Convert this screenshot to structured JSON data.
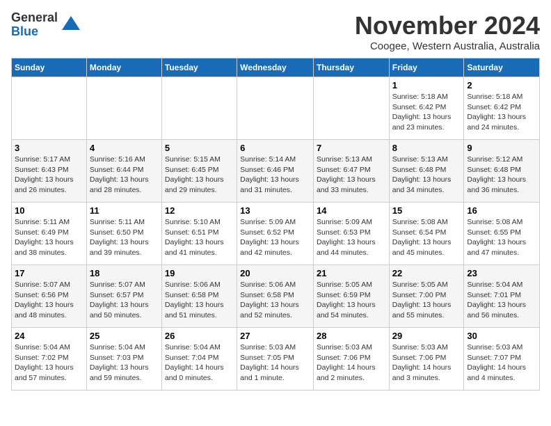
{
  "logo": {
    "general": "General",
    "blue": "Blue"
  },
  "title": "November 2024",
  "location": "Coogee, Western Australia, Australia",
  "days_of_week": [
    "Sunday",
    "Monday",
    "Tuesday",
    "Wednesday",
    "Thursday",
    "Friday",
    "Saturday"
  ],
  "weeks": [
    [
      {
        "day": "",
        "info": ""
      },
      {
        "day": "",
        "info": ""
      },
      {
        "day": "",
        "info": ""
      },
      {
        "day": "",
        "info": ""
      },
      {
        "day": "",
        "info": ""
      },
      {
        "day": "1",
        "info": "Sunrise: 5:18 AM\nSunset: 6:42 PM\nDaylight: 13 hours\nand 23 minutes."
      },
      {
        "day": "2",
        "info": "Sunrise: 5:18 AM\nSunset: 6:42 PM\nDaylight: 13 hours\nand 24 minutes."
      }
    ],
    [
      {
        "day": "3",
        "info": "Sunrise: 5:17 AM\nSunset: 6:43 PM\nDaylight: 13 hours\nand 26 minutes."
      },
      {
        "day": "4",
        "info": "Sunrise: 5:16 AM\nSunset: 6:44 PM\nDaylight: 13 hours\nand 28 minutes."
      },
      {
        "day": "5",
        "info": "Sunrise: 5:15 AM\nSunset: 6:45 PM\nDaylight: 13 hours\nand 29 minutes."
      },
      {
        "day": "6",
        "info": "Sunrise: 5:14 AM\nSunset: 6:46 PM\nDaylight: 13 hours\nand 31 minutes."
      },
      {
        "day": "7",
        "info": "Sunrise: 5:13 AM\nSunset: 6:47 PM\nDaylight: 13 hours\nand 33 minutes."
      },
      {
        "day": "8",
        "info": "Sunrise: 5:13 AM\nSunset: 6:48 PM\nDaylight: 13 hours\nand 34 minutes."
      },
      {
        "day": "9",
        "info": "Sunrise: 5:12 AM\nSunset: 6:48 PM\nDaylight: 13 hours\nand 36 minutes."
      }
    ],
    [
      {
        "day": "10",
        "info": "Sunrise: 5:11 AM\nSunset: 6:49 PM\nDaylight: 13 hours\nand 38 minutes."
      },
      {
        "day": "11",
        "info": "Sunrise: 5:11 AM\nSunset: 6:50 PM\nDaylight: 13 hours\nand 39 minutes."
      },
      {
        "day": "12",
        "info": "Sunrise: 5:10 AM\nSunset: 6:51 PM\nDaylight: 13 hours\nand 41 minutes."
      },
      {
        "day": "13",
        "info": "Sunrise: 5:09 AM\nSunset: 6:52 PM\nDaylight: 13 hours\nand 42 minutes."
      },
      {
        "day": "14",
        "info": "Sunrise: 5:09 AM\nSunset: 6:53 PM\nDaylight: 13 hours\nand 44 minutes."
      },
      {
        "day": "15",
        "info": "Sunrise: 5:08 AM\nSunset: 6:54 PM\nDaylight: 13 hours\nand 45 minutes."
      },
      {
        "day": "16",
        "info": "Sunrise: 5:08 AM\nSunset: 6:55 PM\nDaylight: 13 hours\nand 47 minutes."
      }
    ],
    [
      {
        "day": "17",
        "info": "Sunrise: 5:07 AM\nSunset: 6:56 PM\nDaylight: 13 hours\nand 48 minutes."
      },
      {
        "day": "18",
        "info": "Sunrise: 5:07 AM\nSunset: 6:57 PM\nDaylight: 13 hours\nand 50 minutes."
      },
      {
        "day": "19",
        "info": "Sunrise: 5:06 AM\nSunset: 6:58 PM\nDaylight: 13 hours\nand 51 minutes."
      },
      {
        "day": "20",
        "info": "Sunrise: 5:06 AM\nSunset: 6:58 PM\nDaylight: 13 hours\nand 52 minutes."
      },
      {
        "day": "21",
        "info": "Sunrise: 5:05 AM\nSunset: 6:59 PM\nDaylight: 13 hours\nand 54 minutes."
      },
      {
        "day": "22",
        "info": "Sunrise: 5:05 AM\nSunset: 7:00 PM\nDaylight: 13 hours\nand 55 minutes."
      },
      {
        "day": "23",
        "info": "Sunrise: 5:04 AM\nSunset: 7:01 PM\nDaylight: 13 hours\nand 56 minutes."
      }
    ],
    [
      {
        "day": "24",
        "info": "Sunrise: 5:04 AM\nSunset: 7:02 PM\nDaylight: 13 hours\nand 57 minutes."
      },
      {
        "day": "25",
        "info": "Sunrise: 5:04 AM\nSunset: 7:03 PM\nDaylight: 13 hours\nand 59 minutes."
      },
      {
        "day": "26",
        "info": "Sunrise: 5:04 AM\nSunset: 7:04 PM\nDaylight: 14 hours\nand 0 minutes."
      },
      {
        "day": "27",
        "info": "Sunrise: 5:03 AM\nSunset: 7:05 PM\nDaylight: 14 hours\nand 1 minute."
      },
      {
        "day": "28",
        "info": "Sunrise: 5:03 AM\nSunset: 7:06 PM\nDaylight: 14 hours\nand 2 minutes."
      },
      {
        "day": "29",
        "info": "Sunrise: 5:03 AM\nSunset: 7:06 PM\nDaylight: 14 hours\nand 3 minutes."
      },
      {
        "day": "30",
        "info": "Sunrise: 5:03 AM\nSunset: 7:07 PM\nDaylight: 14 hours\nand 4 minutes."
      }
    ]
  ]
}
